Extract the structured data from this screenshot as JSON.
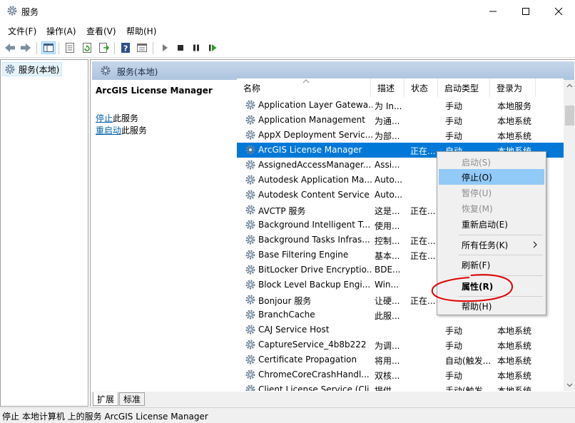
{
  "window": {
    "title": "服务",
    "controls": [
      "minimize-icon",
      "maximize-icon",
      "close-icon"
    ]
  },
  "menu": [
    "文件(F)",
    "操作(A)",
    "查看(V)",
    "帮助(H)"
  ],
  "tree": {
    "root_label": "服务(本地)"
  },
  "pane": {
    "header": "服务(本地)",
    "selected_service": "ArcGIS License Manager",
    "action1_link": "停止",
    "action1_suffix": "此服务",
    "action2_link": "重启动",
    "action2_suffix": "此服务"
  },
  "columns": [
    "名称",
    "描述",
    "状态",
    "启动类型",
    "登录为"
  ],
  "services": [
    {
      "name": "Application Layer Gatewa...",
      "desc": "为 In...",
      "status": "",
      "startup": "手动",
      "logon": "本地服务"
    },
    {
      "name": "Application Management",
      "desc": "为通...",
      "status": "",
      "startup": "手动",
      "logon": "本地系统"
    },
    {
      "name": "AppX Deployment Servic...",
      "desc": "为部...",
      "status": "",
      "startup": "手动",
      "logon": "本地系统"
    },
    {
      "name": "ArcGIS License Manager",
      "desc": "",
      "status": "正在...",
      "startup": "自动",
      "logon": "本地系统"
    },
    {
      "name": "AssignedAccessManager...",
      "desc": "Assi...",
      "status": "",
      "startup": "",
      "logon": ""
    },
    {
      "name": "Autodesk Application Ma...",
      "desc": "Auto...",
      "status": "",
      "startup": "",
      "logon": ""
    },
    {
      "name": "Autodesk Content Service",
      "desc": "Auto...",
      "status": "",
      "startup": "",
      "logon": ""
    },
    {
      "name": "AVCTP 服务",
      "desc": "这是...",
      "status": "正在...",
      "startup": "",
      "logon": ""
    },
    {
      "name": "Background Intelligent T...",
      "desc": "使用...",
      "status": "",
      "startup": "",
      "logon": ""
    },
    {
      "name": "Background Tasks Infras...",
      "desc": "控制...",
      "status": "正在...",
      "startup": "",
      "logon": ""
    },
    {
      "name": "Base Filtering Engine",
      "desc": "基本...",
      "status": "正在...",
      "startup": "",
      "logon": ""
    },
    {
      "name": "BitLocker Drive Encryptio...",
      "desc": "BDE...",
      "status": "",
      "startup": "",
      "logon": ""
    },
    {
      "name": "Block Level Backup Engi...",
      "desc": "Win...",
      "status": "",
      "startup": "",
      "logon": ""
    },
    {
      "name": "Bonjour 服务",
      "desc": "让硬...",
      "status": "正在...",
      "startup": "",
      "logon": ""
    },
    {
      "name": "BranchCache",
      "desc": "此服...",
      "status": "",
      "startup": "",
      "logon": ""
    },
    {
      "name": "CAJ Service Host",
      "desc": "",
      "status": "",
      "startup": "手动",
      "logon": "本地系统"
    },
    {
      "name": "CaptureService_4b8b222",
      "desc": "为调...",
      "status": "",
      "startup": "手动",
      "logon": "本地系统"
    },
    {
      "name": "Certificate Propagation",
      "desc": "将用...",
      "status": "",
      "startup": "自动(触发...",
      "logon": "本地系统"
    },
    {
      "name": "ChromeCoreCrashHandl...",
      "desc": "双核...",
      "status": "",
      "startup": "手动",
      "logon": "本地系统"
    },
    {
      "name": "Client License Service (Cli...",
      "desc": "提供...",
      "status": "",
      "startup": "手动(触发...",
      "logon": "本地系统"
    }
  ],
  "tabs": [
    "扩展",
    "标准"
  ],
  "status_text": "停止 本地计算机 上的服务 ArcGIS License Manager",
  "context_menu": [
    {
      "label": "启动(S)",
      "state": "disabled"
    },
    {
      "label": "停止(O)",
      "state": "hover"
    },
    {
      "label": "暂停(U)",
      "state": "disabled"
    },
    {
      "label": "恢复(M)",
      "state": "disabled"
    },
    {
      "label": "重新启动(E)",
      "state": "normal"
    },
    {
      "label": "所有任务(K)",
      "state": "normal"
    },
    {
      "label": "刷新(F)",
      "state": "normal"
    },
    {
      "label": "属性(R)",
      "state": "bold"
    },
    {
      "label": "帮助(H)",
      "state": "normal"
    }
  ],
  "colors": {
    "selection": "#0078d7",
    "menu_hover": "#91c9f7",
    "link": "#0063b1",
    "annotation": "#e00000"
  }
}
